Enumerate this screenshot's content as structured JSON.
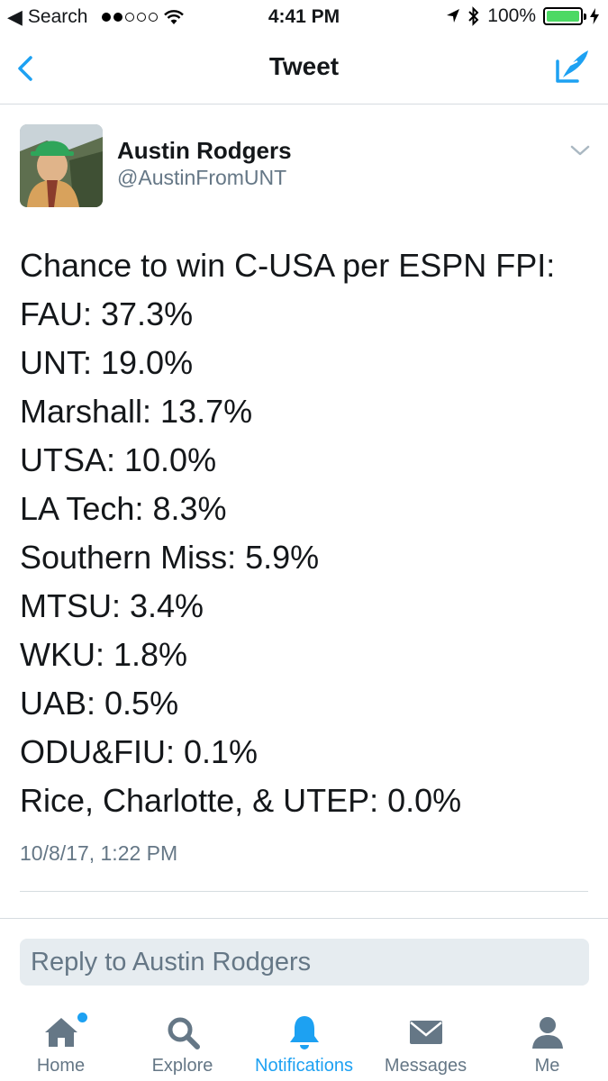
{
  "status_bar": {
    "back_app": "Search",
    "time": "4:41 PM",
    "battery": "100%",
    "battery_level": 1.0
  },
  "nav": {
    "title": "Tweet",
    "back_icon": "chevron-left-icon",
    "compose_icon": "compose-tweet-icon"
  },
  "tweet": {
    "author_name": "Austin Rodgers",
    "author_handle": "@AustinFromUNT",
    "lines": [
      "Chance to win C-USA per ESPN FPI:",
      "FAU: 37.3%",
      "UNT: 19.0%",
      "Marshall: 13.7%",
      "UTSA: 10.0%",
      "LA Tech: 8.3%",
      "Southern Miss: 5.9%",
      "MTSU: 3.4%",
      "WKU: 1.8%",
      "UAB: 0.5%",
      "ODU&FIU: 0.1%",
      "Rice, Charlotte, & UTEP: 0.0%"
    ],
    "timestamp": "10/8/17, 1:22 PM"
  },
  "reply": {
    "placeholder": "Reply to Austin Rodgers"
  },
  "tabs": [
    {
      "label": "Home",
      "icon": "home-icon",
      "active": false,
      "has_dot": true
    },
    {
      "label": "Explore",
      "icon": "search-icon",
      "active": false
    },
    {
      "label": "Notifications",
      "icon": "bell-icon",
      "active": true
    },
    {
      "label": "Messages",
      "icon": "envelope-icon",
      "active": false
    },
    {
      "label": "Me",
      "icon": "person-icon",
      "active": false
    }
  ],
  "colors": {
    "accent": "#1da1f2",
    "text": "#14171a",
    "secondary": "#657786",
    "battery": "#4cd964"
  }
}
